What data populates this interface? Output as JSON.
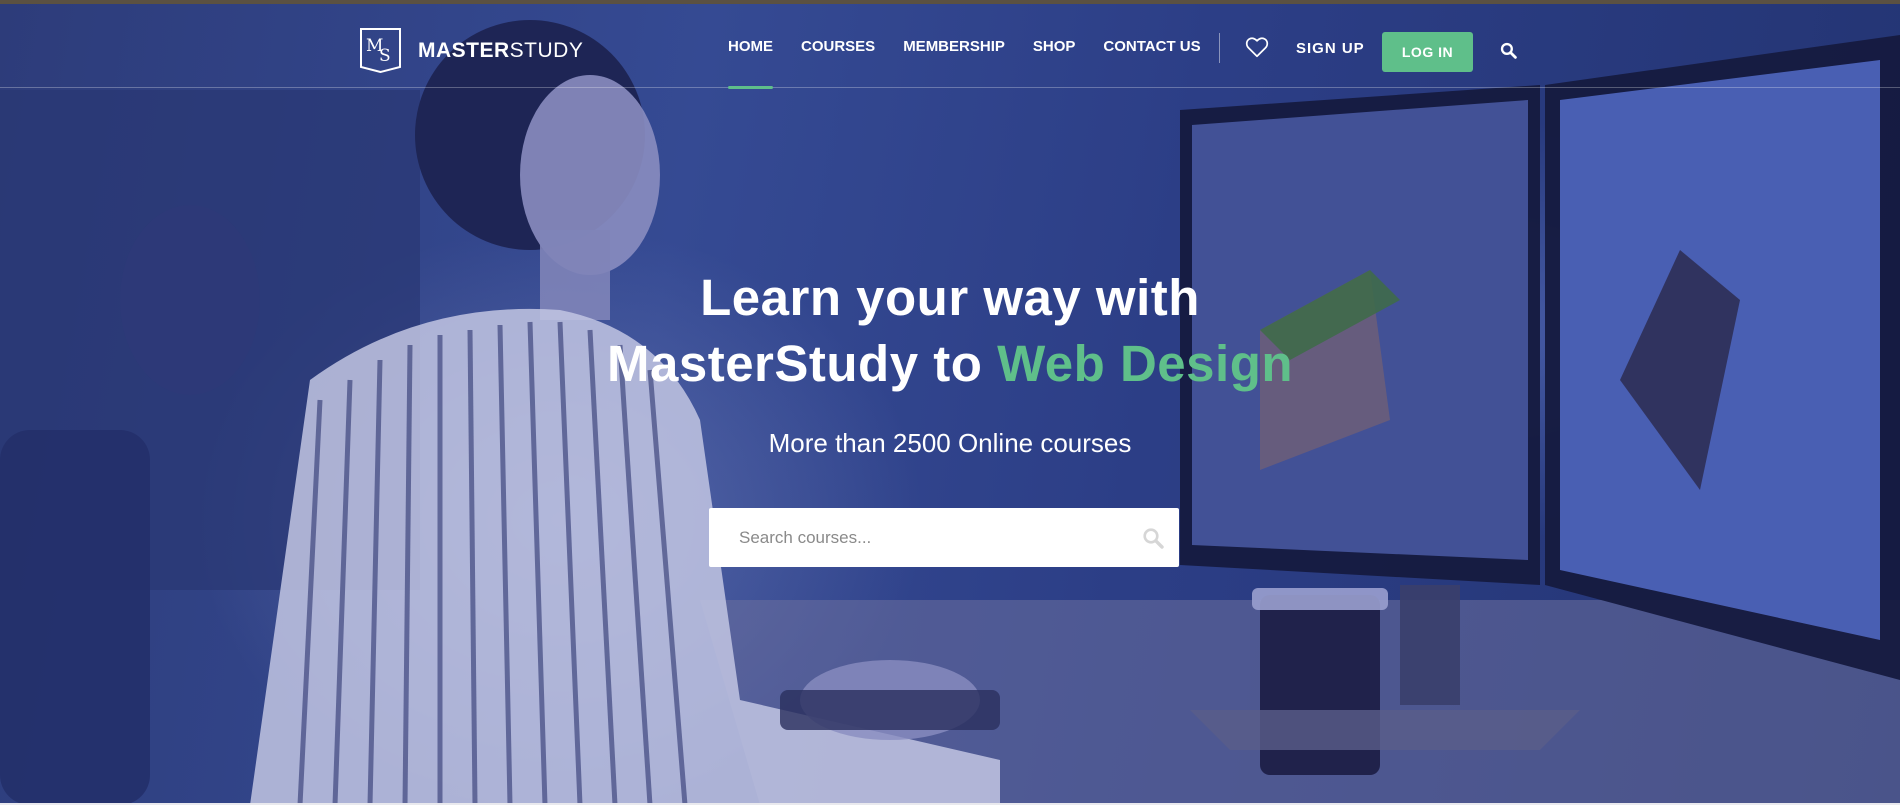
{
  "brand": {
    "mark": "MS",
    "name_bold": "MASTER",
    "name_light": "STUDY"
  },
  "nav": {
    "items": [
      {
        "label": "HOME",
        "active": true
      },
      {
        "label": "COURSES",
        "active": false
      },
      {
        "label": "MEMBERSHIP",
        "active": false
      },
      {
        "label": "SHOP",
        "active": false
      },
      {
        "label": "CONTACT US",
        "active": false
      }
    ],
    "wishlist_icon": "heart-icon",
    "signup_label": "SIGN UP",
    "login_label": "LOG IN",
    "search_icon": "search-icon"
  },
  "hero": {
    "headline_line1": "Learn your way with",
    "headline_line2_prefix": "MasterStudy to",
    "headline_accent": "Web Design",
    "subheadline": "More than 2500 Online courses",
    "search_placeholder": "Search courses...",
    "search_icon": "search-icon"
  },
  "colors": {
    "accent": "#5fbf8a",
    "overlay": "#2f3f87",
    "text": "#ffffff"
  }
}
